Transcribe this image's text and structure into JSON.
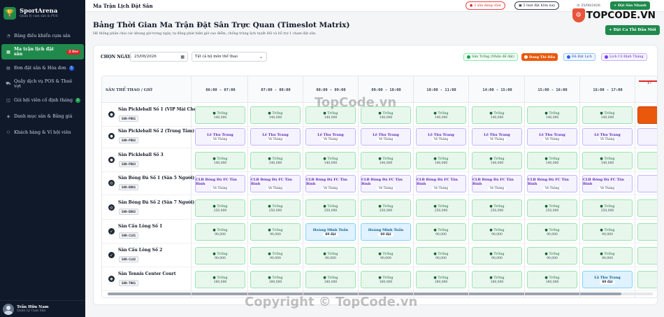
{
  "sidebar": {
    "brand": "SportArena",
    "brand_sub": "Quản lý cụm sân & POS",
    "items": [
      {
        "label": "Bảng điều khiển cụm sân",
        "icon": "dashboard-icon"
      },
      {
        "label": "Ma trận lịch đặt sân",
        "icon": "grid-icon",
        "badge": "2 live",
        "active": true
      },
      {
        "label": "Đơn đặt sân & Hóa đơn",
        "icon": "receipt-icon",
        "badge": "5"
      },
      {
        "label": "Quầy dịch vụ POS & Thuê vợt",
        "icon": "cart-icon"
      },
      {
        "label": "Gói hội viên cố định tháng",
        "icon": "ticket-icon",
        "badge": "2"
      },
      {
        "label": "Danh mục sân & Bảng giá",
        "icon": "layers-icon"
      },
      {
        "label": "Khách hàng & Ví hội viên",
        "icon": "users-icon"
      }
    ],
    "user": {
      "name": "Trần Hữu Nam",
      "role": "Quản Lý Cụm Sân"
    }
  },
  "topbar": {
    "title": "Ma Trận Lịch Đặt Sân",
    "live_pill": "2 sân đang chơi",
    "bookings_pill": "5 lượt đặt hôm nay",
    "date_pill": "25/08/2026",
    "new_booking": "Đặt Sân Nhanh"
  },
  "watermark": {
    "logo": "TOPCODE.VN",
    "center": "TopCode.vn",
    "bottom": "Copyright © TopCode.vn"
  },
  "page": {
    "title": "Bảng Thời Gian Ma Trận Đặt Sân Trực Quan (Timeslot Matrix)",
    "desc": "Hệ thống phân chia các khung giờ trong ngày, tự động phát hiện giờ cao điểm, chống trùng lịch tuyệt đối và hỗ trợ 1 chạm đặt sân.",
    "event_button": "Đặt Ca Thi Đấu Mới"
  },
  "controls": {
    "date_label": "CHỌN NGÀY:",
    "date_value": "25/08/2026",
    "sport_select": "Tất cả bộ môn thể thao"
  },
  "legend": {
    "free": "Sân Trống (Nhấn để đặt)",
    "live": "Đang Thi Đấu",
    "booked": "Đã Đặt Lịch",
    "fixed": "Lịch Cố Định Tháng",
    "colors": {
      "free": "#e8f7ec",
      "live": "#ea580c",
      "booked": "#e0f2fe",
      "fixed": "#f5f3ff"
    }
  },
  "matrix": {
    "corner_label": "SÂN THỂ THAO / GIỜ",
    "slots": [
      "06:00 - 07:00",
      "07:00 - 08:00",
      "08:00 - 09:00",
      "09:00 - 10:00",
      "10:00 - 11:00",
      "14:00 - 15:00",
      "15:00 - 16:00",
      "16:00 - 17:00"
    ],
    "live_slot_label": "17",
    "free_label": "Trống",
    "courts": [
      {
        "name": "Sân Pickleball Số 1 (VIP Mái Che)",
        "code": "SAN-PB01",
        "icon": "pickleball-icon",
        "cells": [
          {
            "type": "free",
            "price": "140,000"
          },
          {
            "type": "free",
            "price": "140,000"
          },
          {
            "type": "free",
            "price": "140,000"
          },
          {
            "type": "free",
            "price": "140,000"
          },
          {
            "type": "free",
            "price": "140,000"
          },
          {
            "type": "free",
            "price": "140,000"
          },
          {
            "type": "free",
            "price": "140,000"
          },
          {
            "type": "free",
            "price": "140,000"
          },
          {
            "type": "live"
          }
        ]
      },
      {
        "name": "Sân Pickleball Số 2 (Trung Tâm)",
        "code": "SAN-PB02",
        "icon": "pickleball-icon",
        "cells": [
          {
            "type": "fixed",
            "customer": "Lê Thu Trang",
            "tag": "Vé Tháng"
          },
          {
            "type": "fixed",
            "customer": "Lê Thu Trang",
            "tag": "Vé Tháng"
          },
          {
            "type": "fixed",
            "customer": "Lê Thu Trang",
            "tag": "Vé Tháng"
          },
          {
            "type": "fixed",
            "customer": "Lê Thu Trang",
            "tag": "Vé Tháng"
          },
          {
            "type": "fixed",
            "customer": "Lê Thu Trang",
            "tag": "Vé Tháng"
          },
          {
            "type": "fixed",
            "customer": "Lê Thu Trang",
            "tag": "Vé Tháng"
          },
          {
            "type": "fixed",
            "customer": "Lê Thu Trang",
            "tag": "Vé Tháng"
          },
          {
            "type": "fixed",
            "customer": "Lê Thu Trang",
            "tag": "Vé Tháng"
          },
          {
            "type": "fixed-edge"
          }
        ]
      },
      {
        "name": "Sân Pickleball Số 3",
        "code": "SAN-PB03",
        "icon": "pickleball-icon",
        "cells": [
          {
            "type": "free",
            "price": "140,000"
          },
          {
            "type": "free",
            "price": "140,000"
          },
          {
            "type": "free",
            "price": "140,000"
          },
          {
            "type": "free",
            "price": "140,000"
          },
          {
            "type": "free",
            "price": "140,000"
          },
          {
            "type": "free",
            "price": "140,000"
          },
          {
            "type": "free",
            "price": "140,000"
          },
          {
            "type": "free",
            "price": "140,000"
          },
          {
            "type": "free-edge"
          }
        ]
      },
      {
        "name": "Sân Bóng Đá Số 1 (Sân 5 Người)",
        "code": "SAN-BD01",
        "icon": "football-icon",
        "cells": [
          {
            "type": "fixed",
            "customer": "CLB Bóng Đá FC Tân Bình",
            "tag": "Vé Tháng"
          },
          {
            "type": "fixed",
            "customer": "CLB Bóng Đá FC Tân Bình",
            "tag": "Vé Tháng"
          },
          {
            "type": "fixed",
            "customer": "CLB Bóng Đá FC Tân Bình",
            "tag": "Vé Tháng"
          },
          {
            "type": "fixed",
            "customer": "CLB Bóng Đá FC Tân Bình",
            "tag": "Vé Tháng"
          },
          {
            "type": "fixed",
            "customer": "CLB Bóng Đá FC Tân Bình",
            "tag": "Vé Tháng"
          },
          {
            "type": "fixed",
            "customer": "CLB Bóng Đá FC Tân Bình",
            "tag": "Vé Tháng"
          },
          {
            "type": "fixed",
            "customer": "CLB Bóng Đá FC Tân Bình",
            "tag": "Vé Tháng"
          },
          {
            "type": "fixed",
            "customer": "CLB Bóng Đá FC Tân Bình",
            "tag": "Vé Tháng"
          },
          {
            "type": "fixed-edge"
          }
        ]
      },
      {
        "name": "Sân Bóng Đá Số 2 (Sân 7 Người)",
        "code": "SAN-BD02",
        "icon": "football-icon",
        "cells": [
          {
            "type": "free",
            "price": "250,000"
          },
          {
            "type": "free",
            "price": "250,000"
          },
          {
            "type": "free",
            "price": "250,000"
          },
          {
            "type": "free",
            "price": "250,000"
          },
          {
            "type": "free",
            "price": "250,000"
          },
          {
            "type": "free",
            "price": "250,000"
          },
          {
            "type": "free",
            "price": "250,000"
          },
          {
            "type": "free",
            "price": "250,000"
          },
          {
            "type": "free-edge"
          }
        ]
      },
      {
        "name": "Sân Cầu Lông Số 1",
        "code": "SAN-CL01",
        "icon": "shuttlecock-icon",
        "cells": [
          {
            "type": "free",
            "price": "90,000"
          },
          {
            "type": "free",
            "price": "90,000"
          },
          {
            "type": "booked",
            "customer": "Hoàng Minh Tuấn",
            "tag": "60 đặt"
          },
          {
            "type": "booked",
            "customer": "Hoàng Minh Tuấn",
            "tag": "60 đặt"
          },
          {
            "type": "free",
            "price": "90,000"
          },
          {
            "type": "free",
            "price": "90,000"
          },
          {
            "type": "free",
            "price": "90,000"
          },
          {
            "type": "free",
            "price": "90,000"
          },
          {
            "type": "free-edge"
          }
        ]
      },
      {
        "name": "Sân Cầu Lông Số 2",
        "code": "SAN-CL02",
        "icon": "shuttlecock-icon",
        "cells": [
          {
            "type": "free",
            "price": "90,000"
          },
          {
            "type": "free",
            "price": "90,000"
          },
          {
            "type": "free",
            "price": "90,000"
          },
          {
            "type": "free",
            "price": "90,000"
          },
          {
            "type": "free",
            "price": "90,000"
          },
          {
            "type": "free",
            "price": "90,000"
          },
          {
            "type": "free",
            "price": "90,000"
          },
          {
            "type": "free",
            "price": "90,000"
          },
          {
            "type": "free-edge"
          }
        ]
      },
      {
        "name": "Sân Tennis Center Court",
        "code": "SAN-TN01",
        "icon": "tennis-icon",
        "cells": [
          {
            "type": "free",
            "price": "180,000"
          },
          {
            "type": "free",
            "price": "180,000"
          },
          {
            "type": "free",
            "price": "180,000"
          },
          {
            "type": "free",
            "price": "180,000"
          },
          {
            "type": "free",
            "price": "180,000"
          },
          {
            "type": "free",
            "price": "180,000"
          },
          {
            "type": "free",
            "price": "180,000"
          },
          {
            "type": "booked",
            "customer": "Lã Thu Trang",
            "tag": "60 đặt"
          },
          {
            "type": "free-edge"
          }
        ]
      }
    ]
  }
}
